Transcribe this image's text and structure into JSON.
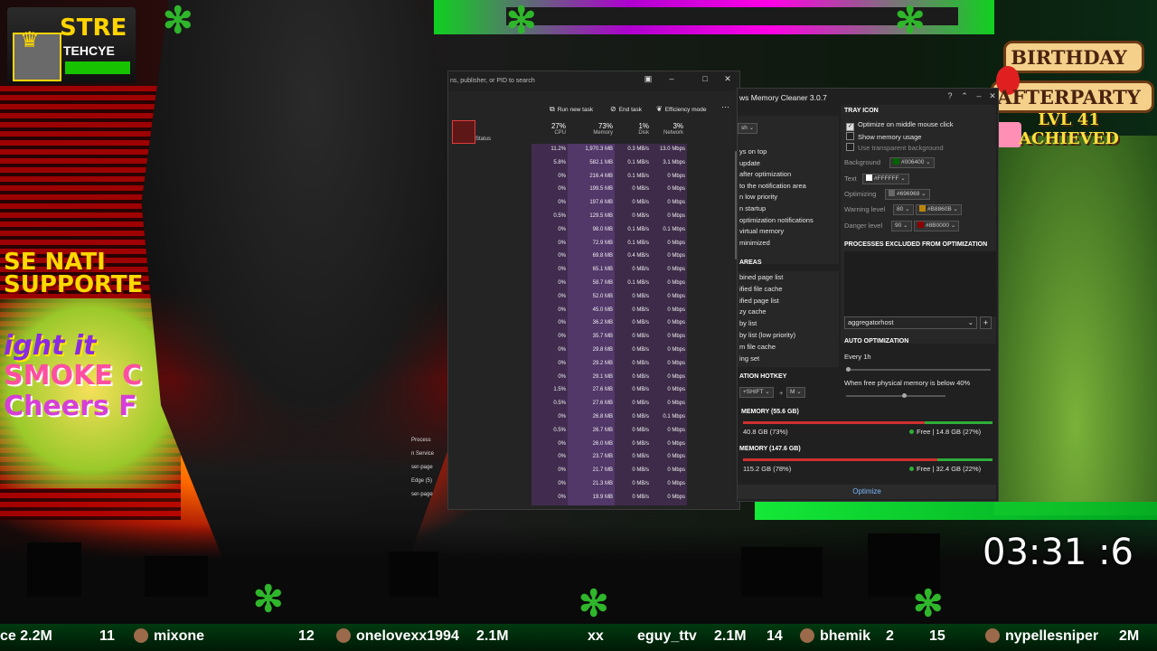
{
  "stream": {
    "streamer_badge": {
      "name_top": "STRE",
      "name_sub": "TEHCYE"
    },
    "left_overlay": [
      "SE NATI",
      "SUPPORTE",
      "ight it",
      "SMOKE C",
      "Cheers F"
    ],
    "birthday_banner": {
      "line1": "BIRTHDAY",
      "line2": "AFTERPARTY",
      "line3": "LVL 41",
      "line4": "ACHIEVED"
    },
    "timer": "03:31 :6",
    "ticker": [
      {
        "text": "ce 2.2M"
      },
      {
        "text": "11"
      },
      {
        "text": "mixone"
      },
      {
        "text": "12"
      },
      {
        "text": "onelovexx1994"
      },
      {
        "text": "2.1M"
      },
      {
        "text": "xx"
      },
      {
        "text": "eguy_ttv"
      },
      {
        "text": "2.1M"
      },
      {
        "text": "14"
      },
      {
        "text": "bhemik"
      },
      {
        "text": "2"
      },
      {
        "text": "15"
      },
      {
        "text": "nypellesniper"
      },
      {
        "text": "2M"
      }
    ]
  },
  "task_manager": {
    "search_placeholder": "ns, publisher, or PID to search",
    "toolbar": {
      "run_new_task": "Run new task",
      "end_task": "End task",
      "efficiency_mode": "Efficiency mode",
      "more": "⋯"
    },
    "status_header": "Status",
    "columns": {
      "cpu": {
        "pct": "27%",
        "label": "CPU"
      },
      "memory": {
        "pct": "73%",
        "label": "Memory"
      },
      "disk": {
        "pct": "1%",
        "label": "Disk"
      },
      "network": {
        "pct": "3%",
        "label": "Network"
      }
    },
    "rows": [
      [
        "11.2%",
        "1,970.3 MB",
        "0.3 MB/s",
        "13.0 Mbps"
      ],
      [
        "5.8%",
        "582.1 MB",
        "0.1 MB/s",
        "3.1 Mbps"
      ],
      [
        "0%",
        "216.4 MB",
        "0.1 MB/s",
        "0 Mbps"
      ],
      [
        "0%",
        "199.5 MB",
        "0 MB/s",
        "0 Mbps"
      ],
      [
        "0%",
        "197.6 MB",
        "0 MB/s",
        "0 Mbps"
      ],
      [
        "0.5%",
        "129.5 MB",
        "0 MB/s",
        "0 Mbps"
      ],
      [
        "0%",
        "98.0 MB",
        "0.1 MB/s",
        "0.1 Mbps"
      ],
      [
        "0%",
        "72.9 MB",
        "0.1 MB/s",
        "0 Mbps"
      ],
      [
        "0%",
        "69.8 MB",
        "0.4 MB/s",
        "0 Mbps"
      ],
      [
        "0%",
        "65.1 MB",
        "0 MB/s",
        "0 Mbps"
      ],
      [
        "0%",
        "58.7 MB",
        "0.1 MB/s",
        "0 Mbps"
      ],
      [
        "0%",
        "52.0 MB",
        "0 MB/s",
        "0 Mbps"
      ],
      [
        "0%",
        "45.0 MB",
        "0 MB/s",
        "0 Mbps"
      ],
      [
        "0%",
        "36.2 MB",
        "0 MB/s",
        "0 Mbps"
      ],
      [
        "0%",
        "35.7 MB",
        "0 MB/s",
        "0 Mbps"
      ],
      [
        "0%",
        "29.8 MB",
        "0 MB/s",
        "0 Mbps"
      ],
      [
        "0%",
        "29.2 MB",
        "0 MB/s",
        "0 Mbps"
      ],
      [
        "0%",
        "29.1 MB",
        "0 MB/s",
        "0 Mbps"
      ],
      [
        "1.5%",
        "27.6 MB",
        "0 MB/s",
        "0 Mbps"
      ],
      [
        "0.5%",
        "27.6 MB",
        "0 MB/s",
        "0 Mbps"
      ],
      [
        "0%",
        "26.8 MB",
        "0 MB/s",
        "0.1 Mbps"
      ],
      [
        "0.5%",
        "26.7 MB",
        "0 MB/s",
        "0 Mbps"
      ],
      [
        "0%",
        "26.0 MB",
        "0 MB/s",
        "0 Mbps"
      ],
      [
        "0%",
        "23.7 MB",
        "0 MB/s",
        "0 Mbps"
      ],
      [
        "0%",
        "21.7 MB",
        "0 MB/s",
        "0 Mbps"
      ],
      [
        "0%",
        "21.3 MB",
        "0 MB/s",
        "0 Mbps"
      ],
      [
        "0%",
        "19.9 MB",
        "0 MB/s",
        "0 Mbps"
      ]
    ],
    "partial_process_names": [
      "Process",
      "n Service",
      "ser-page",
      "Edge (5)",
      "ser-page"
    ]
  },
  "memory_cleaner": {
    "title": "ws Memory Cleaner 3.0.7",
    "left_dropdown": "sh",
    "left_options": [
      "ys on top",
      "update",
      "after optimization",
      " to the notification area",
      "n low priority",
      "n startup",
      " optimization notifications",
      " virtual memory",
      "minimized"
    ],
    "areas_header": "AREAS",
    "areas": [
      "bined page list",
      "ified file cache",
      "ified page list",
      "zy cache",
      "by list",
      "by list (low priority)",
      "m file cache",
      "ing set"
    ],
    "hotkey_header": "ATION HOTKEY",
    "hotkey_mod": "+SHIFT",
    "hotkey_key": "M",
    "tray_icon_header": "TRAY ICON",
    "tray_options": [
      {
        "label": "Optimize on middle mouse click",
        "checked": true
      },
      {
        "label": "Show memory usage",
        "checked": false
      },
      {
        "label": "Use transparent background",
        "checked": false
      }
    ],
    "color_settings": [
      {
        "label": "Background",
        "value": "#006400",
        "color": "#006400"
      },
      {
        "label": "Text",
        "value": "#FFFFFF",
        "color": "#FFFFFF"
      },
      {
        "label": "Optimizing",
        "value": "#696969",
        "color": "#696969"
      }
    ],
    "warning_level": {
      "label": "Warning level",
      "level": "80",
      "value": "#B8860B",
      "color": "#B8860B"
    },
    "danger_level": {
      "label": "Danger level",
      "level": "90",
      "value": "#8B0000",
      "color": "#8B0000"
    },
    "excluded_header": "PROCESSES EXCLUDED FROM OPTIMIZATION",
    "excluded_select": "aggregatorhost",
    "add_button": "+",
    "auto_header": "AUTO OPTIMIZATION",
    "auto_every": "Every 1h",
    "auto_below": "When free physical memory is below 40%",
    "physical_header": "MEMORY (55.6 GB)",
    "physical_used": "40.8 GB (73%)",
    "physical_free": "Free | 14.8 GB (27%)",
    "physical_used_fraction": 0.73,
    "virtual_header": "MEMORY (147.6 GB)",
    "virtual_used": "115.2 GB (78%)",
    "virtual_free": "Free | 32.4 GB (22%)",
    "virtual_used_fraction": 0.78,
    "optimize_button": "Optimize"
  },
  "colors": {
    "accent_blue": "#7ab8ff",
    "used_red": "#d03030",
    "free_green": "#2fae3a"
  }
}
